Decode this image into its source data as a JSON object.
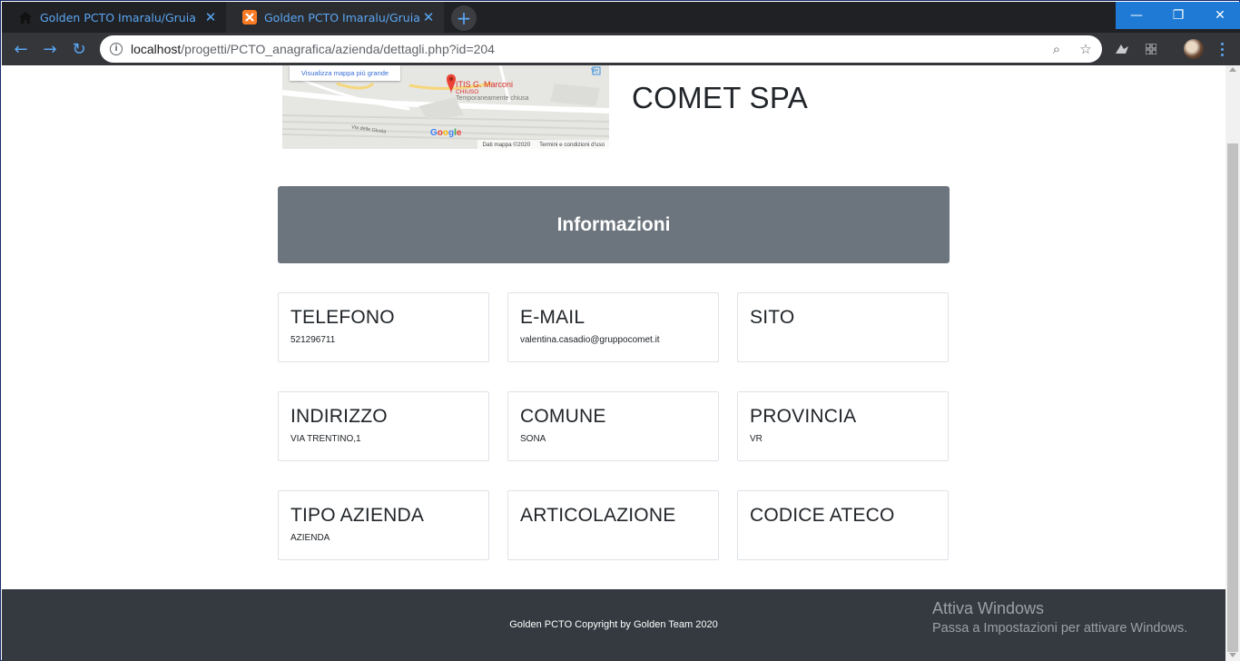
{
  "browser": {
    "tabs": [
      {
        "title": "Golden PCTO Imaralu/Gruia",
        "favicon": "home-icon"
      },
      {
        "title": "Golden PCTO Imaralu/Gruia",
        "favicon": "xampp-icon"
      }
    ],
    "close_glyph": "✕",
    "new_tab_glyph": "+",
    "url": {
      "host": "localhost",
      "path": "/progetti/PCTO_anagrafica/azienda/dettagli.php?id=204"
    },
    "window_controls": {
      "minimize": "—",
      "restore": "❐",
      "close": "✕"
    },
    "nav": {
      "back": "←",
      "forward": "→",
      "reload": "↻"
    },
    "omni_icons": {
      "zoom": "⌕",
      "star": "☆"
    }
  },
  "map": {
    "open_larger": "Visualizza mappa più grande",
    "poi_name": "ITIS G. Marconi",
    "poi_status": "CHIUSO",
    "poi_note": "Temporaneamente chiusa",
    "street": "Via delle Giusta",
    "corner_label": "Ve",
    "brand": "Google",
    "attribution": "Dati mappa ©2020",
    "terms": "Termini e condizioni d'uso"
  },
  "company_name": "COMET SPA",
  "section_title": "Informazioni",
  "cards": [
    {
      "title": "TELEFONO",
      "value": "521296711"
    },
    {
      "title": "E-MAIL",
      "value": "valentina.casadio@gruppocomet.it"
    },
    {
      "title": "SITO",
      "value": ""
    },
    {
      "title": "INDIRIZZO",
      "value": "VIA TRENTINO,1"
    },
    {
      "title": "COMUNE",
      "value": "SONA"
    },
    {
      "title": "PROVINCIA",
      "value": "VR"
    },
    {
      "title": "TIPO AZIENDA",
      "value": "AZIENDA"
    },
    {
      "title": "ARTICOLAZIONE",
      "value": ""
    },
    {
      "title": "CODICE ATECO",
      "value": ""
    }
  ],
  "footer": {
    "copyright": "Golden PCTO Copyright by Golden Team 2020"
  },
  "watermark": {
    "title": "Attiva Windows",
    "subtitle": "Passa a Impostazioni per attivare Windows."
  },
  "colors": {
    "header_gray": "#6c757d",
    "footer_dark": "#343a40",
    "tab_accent": "#5aa7f5",
    "window_blue": "#1e7ad4"
  }
}
